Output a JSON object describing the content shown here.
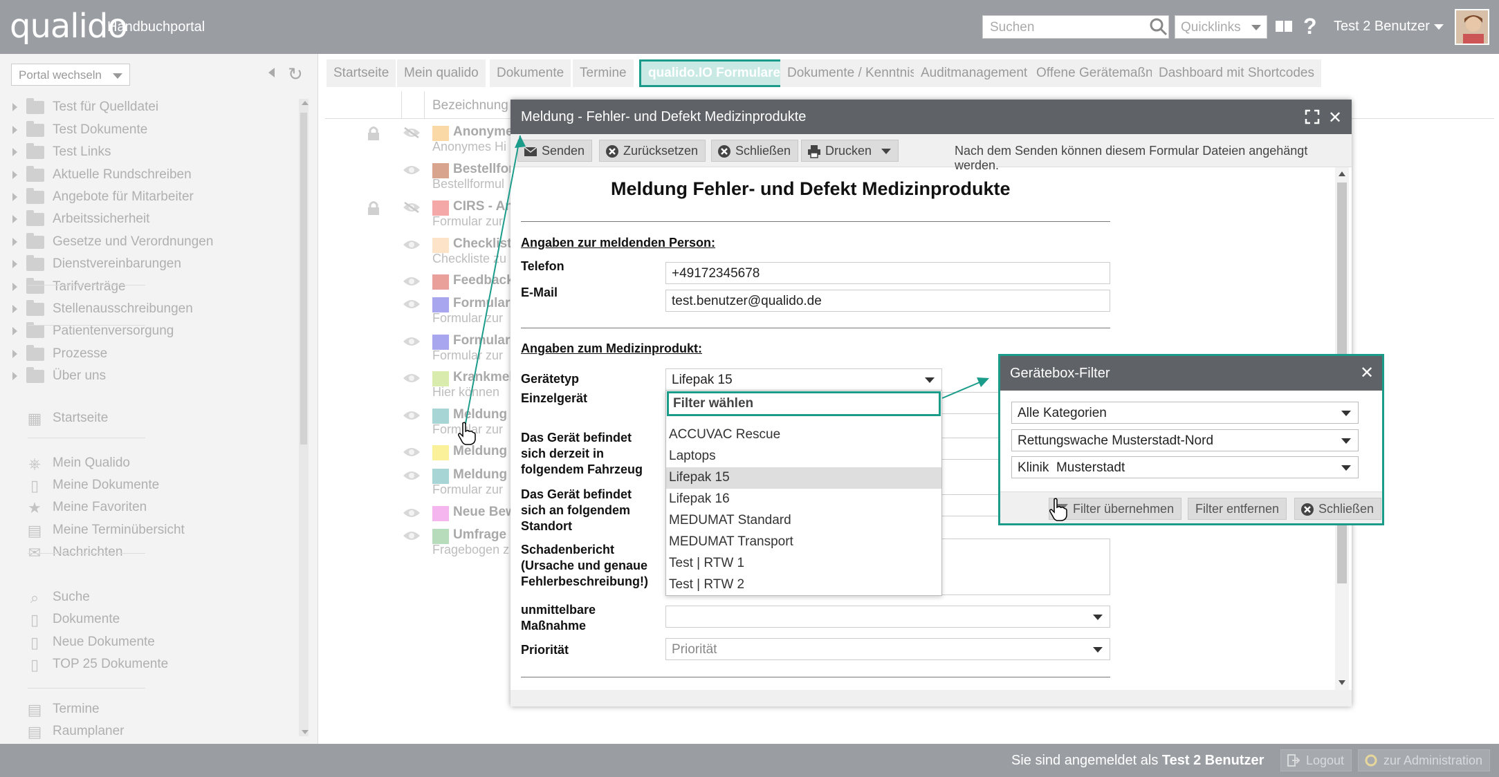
{
  "header": {
    "logo": "qualido",
    "app_title": "Handbuchportal",
    "search_placeholder": "Suchen",
    "quicklinks_label": "Quicklinks",
    "help_label": "?",
    "user_name": "Test 2 Benutzer"
  },
  "sidebar": {
    "portal_switch": "Portal wechseln",
    "tree": [
      "Test für Quelldatei",
      "Test Dokumente",
      "Test Links",
      "Aktuelle Rundschreiben",
      "Angebote für Mitarbeiter",
      "Arbeitssicherheit",
      "Gesetze und Verordnungen",
      "Dienstvereinbarungen",
      "Tarifverträge",
      "Stellenausschreibungen",
      "Patientenversorgung",
      "Prozesse",
      "Über uns"
    ],
    "nav": [
      {
        "label": "Startseite",
        "icon": "grid-icon"
      },
      {
        "label": "Mein Qualido",
        "icon": "apps-icon"
      },
      {
        "label": "Meine Dokumente",
        "icon": "document-icon"
      },
      {
        "label": "Meine Favoriten",
        "icon": "star-icon"
      },
      {
        "label": "Meine Terminübersicht",
        "icon": "calendar-icon"
      },
      {
        "label": "Nachrichten",
        "icon": "envelope-icon"
      },
      {
        "label": "Suche",
        "icon": "search-icon"
      },
      {
        "label": "Dokumente",
        "icon": "document-icon"
      },
      {
        "label": "Neue Dokumente",
        "icon": "document-icon"
      },
      {
        "label": "TOP 25 Dokumente",
        "icon": "document-icon"
      },
      {
        "label": "Termine",
        "icon": "calendar-icon"
      },
      {
        "label": "Raumplaner",
        "icon": "calendar-icon"
      }
    ]
  },
  "tabs": [
    "Startseite",
    "Mein qualido",
    "Dokumente",
    "Termine",
    "qualido.IO Formulare",
    "Dokumente / Kenntnisnahme",
    "Auditmanagement",
    "Offene Gerätemaßnahmen",
    "Dashboard mit Shortcodes"
  ],
  "active_tab": "qualido.IO Formulare",
  "list": {
    "column_name": "Bezeichnung",
    "rows": [
      {
        "title": "Anonyme",
        "subtitle": "Anonymes Hi",
        "color": "#fbd9a6",
        "lock": true,
        "eye_crossed": true
      },
      {
        "title": "Bestellfor",
        "subtitle": "Bestellformul",
        "color": "#d8a48e",
        "lock": false,
        "eye_crossed": false
      },
      {
        "title": "CIRS - An",
        "subtitle": "Formular zur",
        "color": "#f5a8a8",
        "lock": true,
        "eye_crossed": true
      },
      {
        "title": "Checkliste",
        "subtitle": "Checkliste zu",
        "color": "#fde3c8",
        "lock": false,
        "eye_crossed": false
      },
      {
        "title": "Feedback",
        "subtitle": "",
        "color": "#e9a09a",
        "lock": false,
        "eye_crossed": false
      },
      {
        "title": "Formular",
        "subtitle": "Formular zur",
        "color": "#a9a6f0",
        "lock": false,
        "eye_crossed": false
      },
      {
        "title": "Formular",
        "subtitle": "Formular zur",
        "color": "#a9a6f0",
        "lock": false,
        "eye_crossed": false
      },
      {
        "title": "Krankmel",
        "subtitle": "Hier können",
        "color": "#d9ecae",
        "lock": false,
        "eye_crossed": false
      },
      {
        "title": "Meldung -",
        "subtitle": "Formular zur",
        "color": "#a7d4d4",
        "lock": false,
        "eye_crossed": false
      },
      {
        "title": "Meldung -",
        "subtitle": "",
        "color": "#fbf19a",
        "lock": false,
        "eye_crossed": false
      },
      {
        "title": "Meldung -",
        "subtitle": "Formular zur",
        "color": "#a7d4d4",
        "lock": false,
        "eye_crossed": false
      },
      {
        "title": "Neue Bew",
        "subtitle": "",
        "color": "#f5b6f0",
        "lock": false,
        "eye_crossed": false
      },
      {
        "title": "Umfrage -",
        "subtitle": "Fragebogen z",
        "color": "#b7dcbc",
        "lock": false,
        "eye_crossed": false
      }
    ]
  },
  "modal": {
    "title": "Meldung - Fehler- und Defekt Medizinprodukte",
    "toolbar": {
      "send": "Senden",
      "reset": "Zurücksetzen",
      "close": "Schließen",
      "print": "Drucken",
      "hint": "Nach dem Senden können diesem Formular Dateien angehängt werden."
    },
    "form": {
      "heading": "Meldung Fehler- und Defekt Medizinprodukte",
      "section_person": "Angaben zur meldenden Person:",
      "phone_label": "Telefon",
      "phone_value": "+49172345678",
      "email_label": "E-Mail",
      "email_value": "test.benutzer@qualido.de",
      "section_product": "Angaben zum Medizinprodukt:",
      "device_type_label": "Gerätetyp",
      "device_type_value": "Lifepak 15",
      "single_device_label": "Einzelgerät",
      "vehicle_label": "Das Gerät befindet sich derzeit in folgendem Fahrzeug",
      "location_label": "Das Gerät befindet sich an folgendem Standort",
      "damage_label": "Schadenbericht (Ursache und genaue Fehlerbeschreibung!)",
      "measure_label": "unmittelbare Maßnahme",
      "priority_label": "Priorität",
      "priority_placeholder": "Priorität"
    }
  },
  "dropdown": {
    "filter_label": "Filter wählen",
    "options": [
      "ACCUVAC Rescue",
      "Laptops",
      "Lifepak 15",
      "Lifepak 16",
      "MEDUMAT Standard",
      "MEDUMAT Transport",
      "Test | RTW 1",
      "Test | RTW 2"
    ],
    "selected": "Lifepak 15"
  },
  "filter_dialog": {
    "title": "Gerätebox-Filter",
    "category": "Alle Kategorien",
    "station": "Rettungswache Musterstadt-Nord",
    "clinic": "Klinik  Musterstadt",
    "apply": "Filter übernehmen",
    "remove": "Filter entfernen",
    "close": "Schließen"
  },
  "footer": {
    "logged_in_prefix": "Sie sind angemeldet als",
    "logged_in_user": "Test 2 Benutzer",
    "logout": "Logout",
    "admin": "zur Administration"
  },
  "colors": {
    "accent": "#1b9b8a",
    "header_bg": "#9a9ea3",
    "dialog_title_bg": "#5f6266"
  }
}
